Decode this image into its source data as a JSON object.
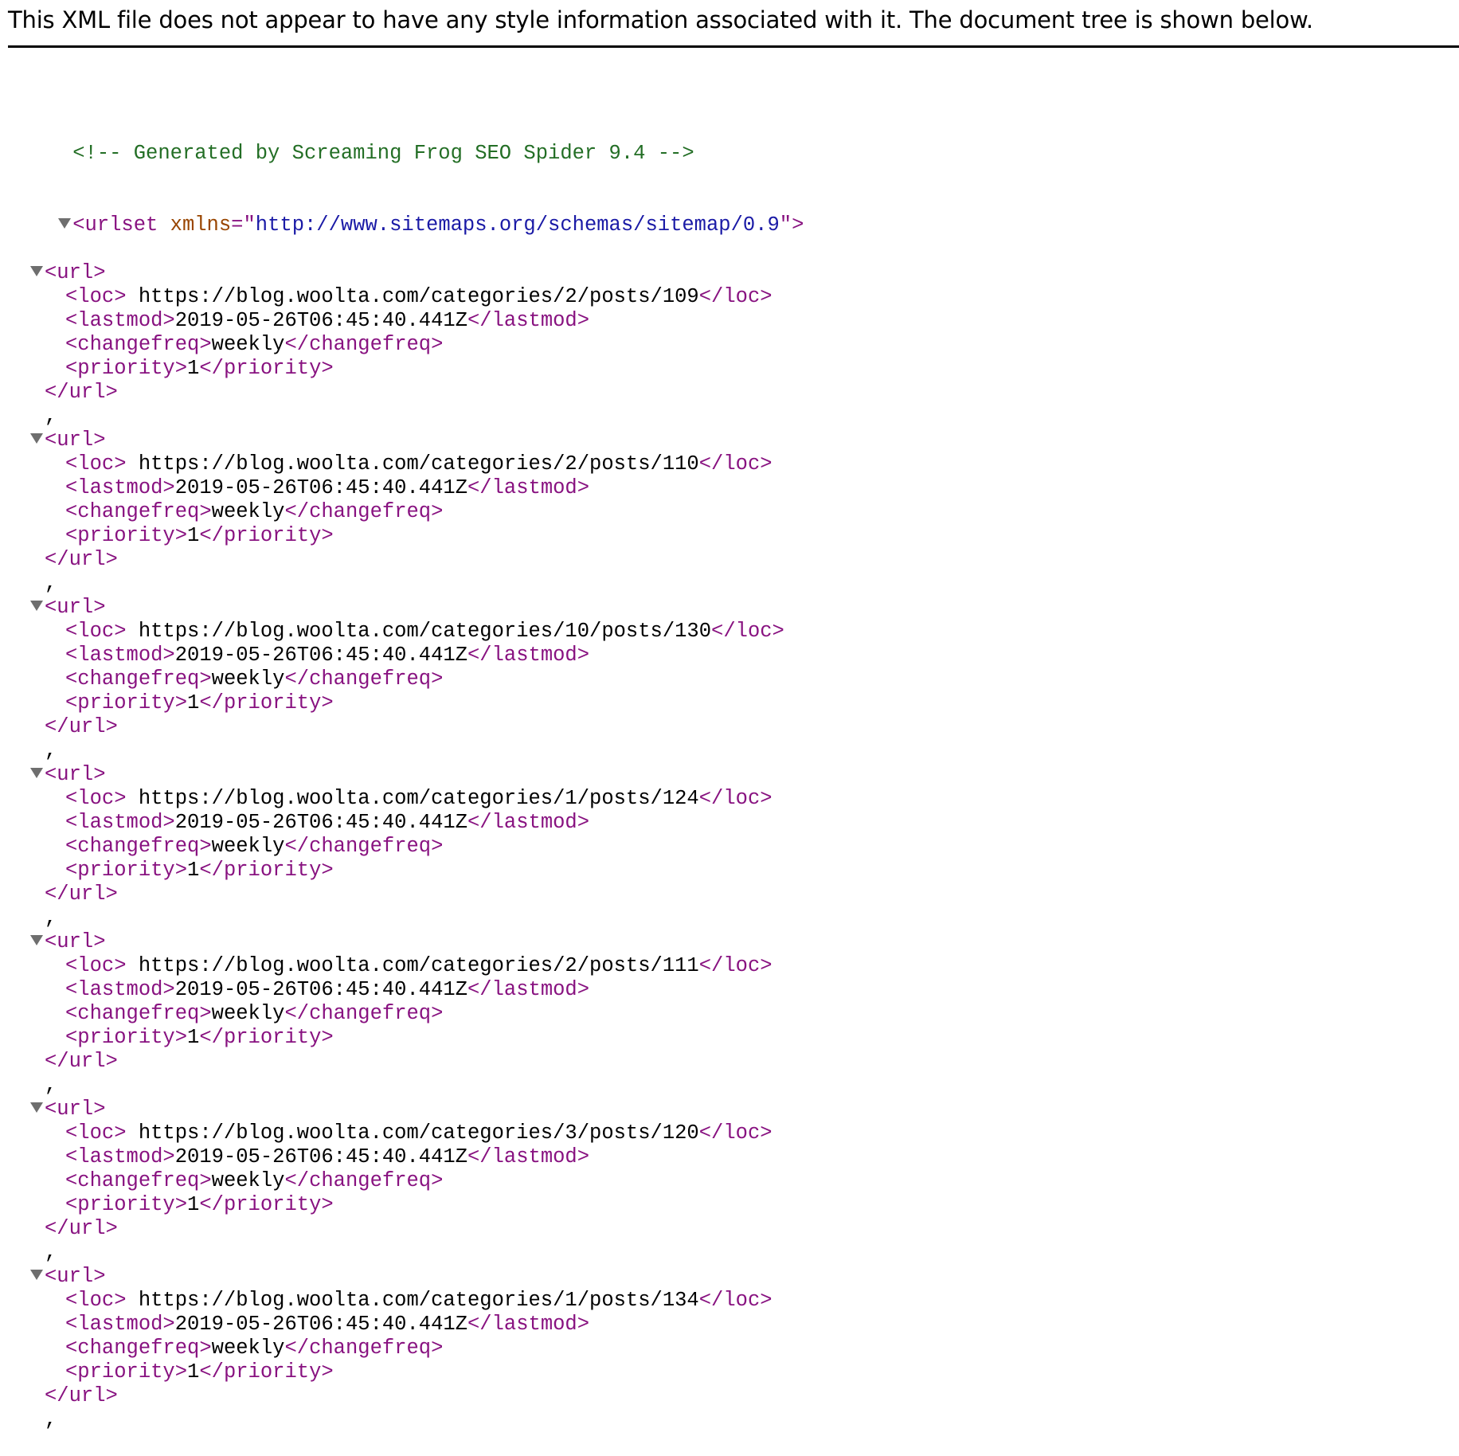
{
  "info": {
    "message": "This XML file does not appear to have any style information associated with it. The document tree is shown below."
  },
  "tree": {
    "comment": "<!-- Generated by Screaming Frog SEO Spider 9.4 -->",
    "root": {
      "open_tag": "<urlset",
      "attr_name": " xmlns",
      "attr_eq": "=\"",
      "attr_value": "http://www.sitemaps.org/schemas/sitemap/0.9",
      "attr_close": "\">"
    },
    "tags": {
      "url_open": "<url>",
      "url_close": "</url>",
      "loc_open": "<loc>",
      "loc_close": "</loc>",
      "lastmod_open": "<lastmod>",
      "lastmod_close": "</lastmod>",
      "changefreq_open": "<changefreq>",
      "changefreq_close": "</changefreq>",
      "priority_open": "<priority>",
      "priority_close": "</priority>",
      "separator": ","
    },
    "urls": [
      {
        "loc": " https://blog.woolta.com/categories/2/posts/109",
        "lastmod": "2019-05-26T06:45:40.441Z",
        "changefreq": "weekly",
        "priority": "1"
      },
      {
        "loc": " https://blog.woolta.com/categories/2/posts/110",
        "lastmod": "2019-05-26T06:45:40.441Z",
        "changefreq": "weekly",
        "priority": "1"
      },
      {
        "loc": " https://blog.woolta.com/categories/10/posts/130",
        "lastmod": "2019-05-26T06:45:40.441Z",
        "changefreq": "weekly",
        "priority": "1"
      },
      {
        "loc": " https://blog.woolta.com/categories/1/posts/124",
        "lastmod": "2019-05-26T06:45:40.441Z",
        "changefreq": "weekly",
        "priority": "1"
      },
      {
        "loc": " https://blog.woolta.com/categories/2/posts/111",
        "lastmod": "2019-05-26T06:45:40.441Z",
        "changefreq": "weekly",
        "priority": "1"
      },
      {
        "loc": " https://blog.woolta.com/categories/3/posts/120",
        "lastmod": "2019-05-26T06:45:40.441Z",
        "changefreq": "weekly",
        "priority": "1"
      },
      {
        "loc": " https://blog.woolta.com/categories/1/posts/134",
        "lastmod": "2019-05-26T06:45:40.441Z",
        "changefreq": "weekly",
        "priority": "1"
      }
    ]
  },
  "colors": {
    "tag": "#881280",
    "comment": "#236e25",
    "attr_name": "#994500",
    "attr_value": "#1a1aa6",
    "toggle": "#6e6e6e"
  }
}
